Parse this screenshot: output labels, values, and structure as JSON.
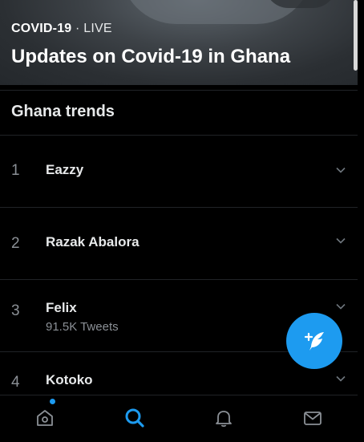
{
  "hero": {
    "topic": "COVID-19",
    "separator": " · ",
    "status": "LIVE",
    "title": "Updates on Covid-19 in Ghana"
  },
  "section": {
    "title": "Ghana trends"
  },
  "trends": [
    {
      "rank": "1",
      "name": "Eazzy",
      "meta": ""
    },
    {
      "rank": "2",
      "name": "Razak Abalora",
      "meta": ""
    },
    {
      "rank": "3",
      "name": "Felix",
      "meta": "91.5K Tweets"
    },
    {
      "rank": "4",
      "name": "Kotoko",
      "meta": ""
    }
  ],
  "fab": {
    "icon": "compose-tweet-icon"
  },
  "nav": {
    "items": [
      "home-icon",
      "search-icon",
      "notifications-icon",
      "messages-icon"
    ],
    "active": "search",
    "notification_dot_color": "#1d9bf0"
  },
  "colors": {
    "accent": "#1d9bf0",
    "background": "#000000",
    "secondary_text": "#8b9096"
  }
}
